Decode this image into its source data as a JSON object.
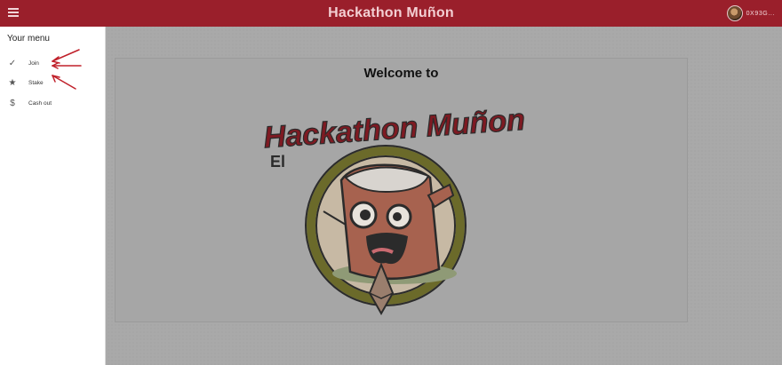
{
  "header": {
    "title": "Hackathon Muñon",
    "menu_icon": "hamburger-icon",
    "account": {
      "address": "0X93G...",
      "avatar": "avatar"
    }
  },
  "sidebar": {
    "title": "Your menu",
    "items": [
      {
        "label": "Join",
        "icon": "check-icon"
      },
      {
        "label": "Stake",
        "icon": "star-icon"
      },
      {
        "label": "Cash out",
        "icon": "dollar-icon"
      }
    ]
  },
  "main": {
    "welcome": "Welcome to",
    "logo": {
      "text": "Hackathon Muñon",
      "prefix": "El"
    }
  },
  "colors": {
    "header": "#9a1f2b",
    "annotation_arrow": "#c0202a",
    "logo_red": "#7e1a22"
  }
}
